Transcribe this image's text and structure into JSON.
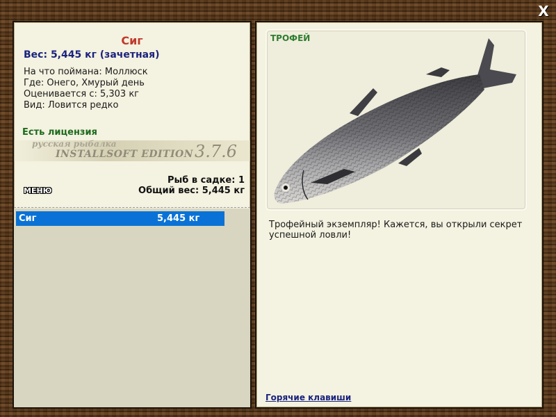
{
  "window": {
    "close_label": "X"
  },
  "left_panel": {
    "fish_name": "Сиг",
    "weight_line": "Вес: 5,445 кг (зачетная)",
    "caught_on": "На что поймана: Моллюск",
    "location": "Где: Онего, Хмурый день",
    "valued_from": "Оценивается с: 5,303 кг",
    "rarity": "Вид: Ловится редко",
    "license": "Есть лицензия",
    "watermark": {
      "line1": "русская рыбалка",
      "line2": "INSTALLSOFT EDITION",
      "version": "3.7.6"
    },
    "menu_label": "МЕНЮ",
    "fish_count": "Рыб в садке: 1",
    "total_weight": "Общий вес: 5,445 кг",
    "catch_list": [
      {
        "name": "Сиг",
        "weight": "5,445 кг"
      }
    ]
  },
  "right_panel": {
    "trophy_label": "ТРОФЕЙ",
    "description": "Трофейный экземпляр! Кажется, вы открыли секрет успешной ловли!",
    "hotkeys_link": "Горячие клавиши"
  },
  "colors": {
    "selection": "#0a72d6",
    "fish_name": "#c0392b",
    "weight": "#1a237e",
    "license": "#1d6b1d",
    "trophy": "#2e7d32"
  }
}
